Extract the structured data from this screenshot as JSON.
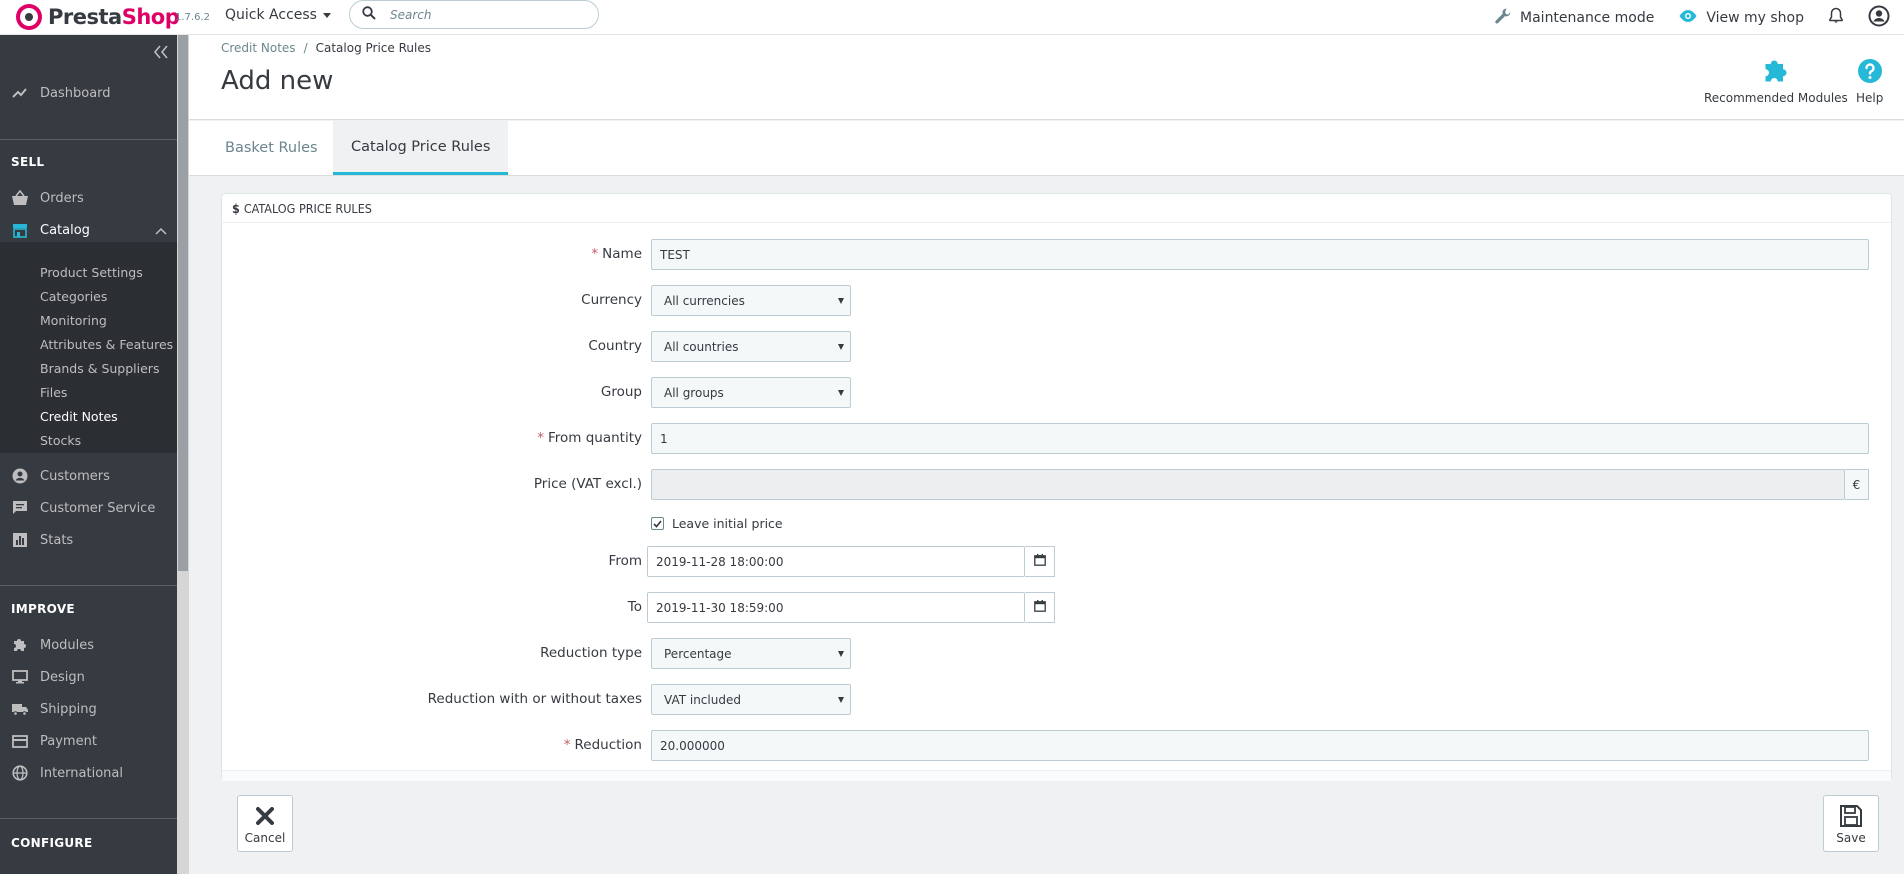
{
  "header": {
    "logo_text": "PrestaShop",
    "version": "1.7.6.2",
    "quick_access": "Quick Access",
    "search_placeholder": "Search",
    "maintenance": "Maintenance mode",
    "view_shop": "View my shop",
    "icons": [
      "search-icon",
      "wrench-icon",
      "eye-icon",
      "bell-icon",
      "user-icon"
    ]
  },
  "sidebar": {
    "dashboard": "Dashboard",
    "sections": {
      "sell": "SELL",
      "improve": "IMPROVE",
      "configure": "CONFIGURE"
    },
    "sell_items": [
      "Orders",
      "Catalog",
      "Customers",
      "Customer Service",
      "Stats"
    ],
    "catalog_submenu": [
      "Product Settings",
      "Categories",
      "Monitoring",
      "Attributes & Features",
      "Brands & Suppliers",
      "Files",
      "Credit Notes",
      "Stocks"
    ],
    "improve_items": [
      "Modules",
      "Design",
      "Shipping",
      "Payment",
      "International"
    ],
    "current_submenu": "Credit Notes"
  },
  "page": {
    "breadcrumb": [
      "Credit Notes",
      "Catalog Price Rules"
    ],
    "title": "Add new",
    "toolbar": {
      "recommended": "Recommended Modules",
      "help": "Help"
    },
    "tabs": [
      "Basket Rules",
      "Catalog Price Rules"
    ],
    "active_tab": "Catalog Price Rules"
  },
  "form": {
    "panel_title": "CATALOG PRICE RULES",
    "currency_symbol": "$",
    "name": {
      "label": "Name",
      "value": "TEST"
    },
    "currency": {
      "label": "Currency",
      "value": "All currencies"
    },
    "country": {
      "label": "Country",
      "value": "All countries"
    },
    "group": {
      "label": "Group",
      "value": "All groups"
    },
    "from_quantity": {
      "label": "From quantity",
      "value": "1"
    },
    "price": {
      "label": "Price (VAT excl.)",
      "value": "",
      "addon": "€"
    },
    "leave_initial": {
      "label": "Leave initial price",
      "checked": true
    },
    "from": {
      "label": "From",
      "value": "2019-11-28 18:00:00"
    },
    "to": {
      "label": "To",
      "value": "2019-11-30 18:59:00"
    },
    "reduction_type": {
      "label": "Reduction type",
      "value": "Percentage"
    },
    "reduction_tax": {
      "label": "Reduction with or without taxes",
      "value": "VAT included"
    },
    "reduction": {
      "label": "Reduction",
      "value": "20.000000"
    },
    "required_mark": "*"
  },
  "footer": {
    "cancel": "Cancel",
    "save": "Save"
  },
  "colors": {
    "brand_pink": "#df0067",
    "accent": "#25b9d7",
    "sidebar": "#363a41"
  }
}
